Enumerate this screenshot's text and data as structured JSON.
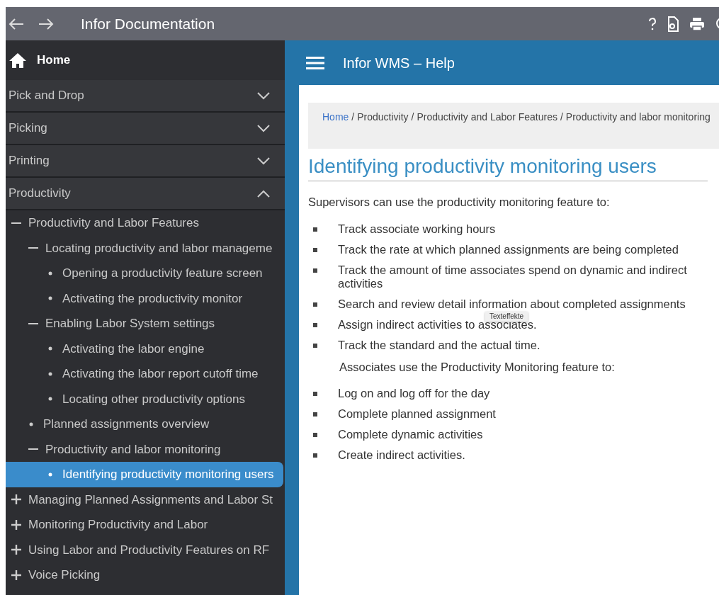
{
  "window": {
    "title": "Infor Documentation"
  },
  "sidebar": {
    "home": "Home",
    "sections": [
      {
        "label": "Pick and Drop",
        "expanded": false
      },
      {
        "label": "Picking",
        "expanded": false
      },
      {
        "label": "Printing",
        "expanded": false
      },
      {
        "label": "Productivity",
        "expanded": true
      }
    ],
    "tree": [
      {
        "label": "Productivity and Labor Features",
        "expanded": true,
        "selected": false,
        "children": [
          {
            "label": "Locating productivity and labor manageme",
            "expanded": true,
            "selected": false,
            "children": [
              {
                "label": "Opening a productivity feature screen",
                "selected": false
              },
              {
                "label": "Activating the productivity monitor",
                "selected": false
              }
            ]
          },
          {
            "label": "Enabling Labor System settings",
            "expanded": true,
            "selected": false,
            "children": [
              {
                "label": "Activating the labor engine",
                "selected": false
              },
              {
                "label": "Activating the labor report cutoff time",
                "selected": false
              },
              {
                "label": "Locating other productivity options",
                "selected": false
              }
            ]
          },
          {
            "label": "Planned assignments overview",
            "selected": false
          },
          {
            "label": "Productivity and labor monitoring",
            "expanded": true,
            "selected": false,
            "children": [
              {
                "label": "Identifying productivity monitoring users",
                "selected": true
              }
            ]
          }
        ]
      },
      {
        "label": "Managing Planned Assignments and Labor St",
        "expanded": false,
        "selected": false
      },
      {
        "label": "Monitoring Productivity and Labor",
        "expanded": false,
        "selected": false
      },
      {
        "label": "Using Labor and Productivity Features on RF",
        "expanded": false,
        "selected": false
      },
      {
        "label": "Voice Picking",
        "expanded": false,
        "selected": false
      }
    ]
  },
  "header": {
    "title": "Infor WMS – Help"
  },
  "breadcrumb_separator": "/",
  "breadcrumb": [
    "Home",
    "Productivity",
    "Productivity and Labor Features",
    "Productivity and labor monitoring"
  ],
  "article": {
    "title": "Identifying productivity monitoring users",
    "blocks": [
      {
        "kind": "paragraph",
        "text": "Supervisors can use the productivity monitoring feature to:"
      },
      {
        "kind": "bullet",
        "text": "Track associate working hours"
      },
      {
        "kind": "bullet",
        "text": "Track the rate at which planned assignments are being completed"
      },
      {
        "kind": "bullet",
        "text": "Track the amount of time associates spend on dynamic and indirect activities"
      },
      {
        "kind": "bullet",
        "text": "Search and review detail information about completed assignments",
        "tooltip": "Texteffekte"
      },
      {
        "kind": "bullet",
        "text": "Assign indirect activities to associates."
      },
      {
        "kind": "bullet",
        "text": "Track the standard and the actual time."
      },
      {
        "kind": "note",
        "text": "Associates use the Productivity Monitoring feature to:"
      },
      {
        "kind": "bullet",
        "text": "Log on and log off for the day"
      },
      {
        "kind": "bullet",
        "text": "Complete planned assignment"
      },
      {
        "kind": "bullet",
        "text": "Complete dynamic activities"
      },
      {
        "kind": "bullet",
        "text": "Create indirect activities."
      }
    ]
  }
}
